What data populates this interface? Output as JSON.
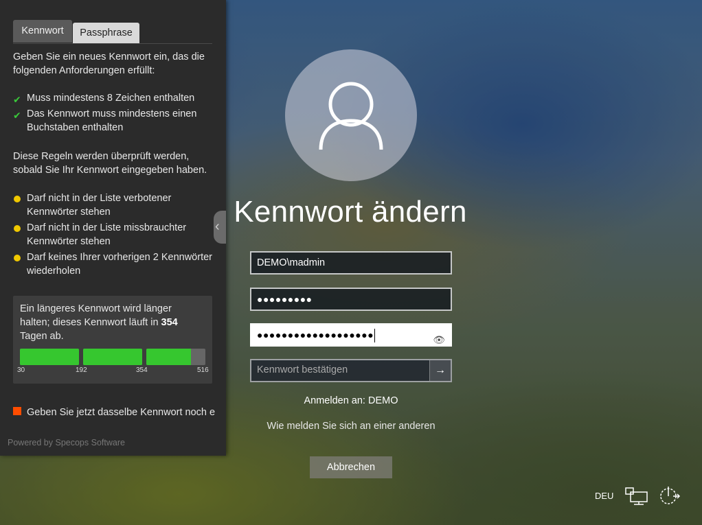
{
  "tabs": [
    {
      "label": "Kennwort"
    },
    {
      "label": "Passphrase"
    }
  ],
  "panel": {
    "intro": "Geben Sie ein neues Kennwort ein, das die folgenden Anforderungen erfüllt:",
    "requirements": [
      {
        "label": "Muss mindestens 8 Zeichen enthalten",
        "status": "met"
      },
      {
        "label": "Das Kennwort muss mindestens einen Buchstaben enthalten",
        "status": "met"
      }
    ],
    "pending_note": "Diese Regeln werden überprüft werden, sobald Sie Ihr Kennwort eingegeben haben.",
    "pending_rules": [
      {
        "label": "Darf nicht in der Liste verbotener Kennwörter stehen",
        "status": "pending"
      },
      {
        "label": "Darf nicht in der Liste missbrauchter Kennwörter stehen",
        "status": "pending"
      },
      {
        "label": "Darf keines Ihrer vorherigen 2 Kennwörter wiederholen",
        "status": "pending"
      }
    ],
    "expiry": {
      "text": "Ein längeres Kennwort wird länger halten; dieses Kennwort läuft in",
      "days": "354",
      "suffix": "Tagen ab.",
      "ticks": [
        "30",
        "192",
        "354",
        "516"
      ],
      "segments_fill": [
        1.0,
        1.0,
        0.75
      ]
    },
    "retype_prompt": "Geben Sie jetzt dasselbe Kennwort noch einmal ein",
    "powered_by": "Powered by Specops Software",
    "colors": {
      "met": "#3ac93a",
      "pending": "#f0c800",
      "retype": "#ff4d00",
      "bar": "#36c72f"
    }
  },
  "login": {
    "title": "Kennwort ändern",
    "username": "DEMO\\madmin",
    "old_password_mask": "●●●●●●●●●",
    "new_password_mask": "●●●●●●●●●●●●●●●●●●●",
    "confirm_placeholder": "Kennwort bestätigen",
    "signin_to": "Anmelden an: DEMO",
    "other_signin": "Wie melden Sie sich an einer anderen",
    "cancel_label": "Abbrechen"
  },
  "tray": {
    "language": "DEU",
    "icons": [
      "network-icon",
      "power-icon"
    ]
  }
}
